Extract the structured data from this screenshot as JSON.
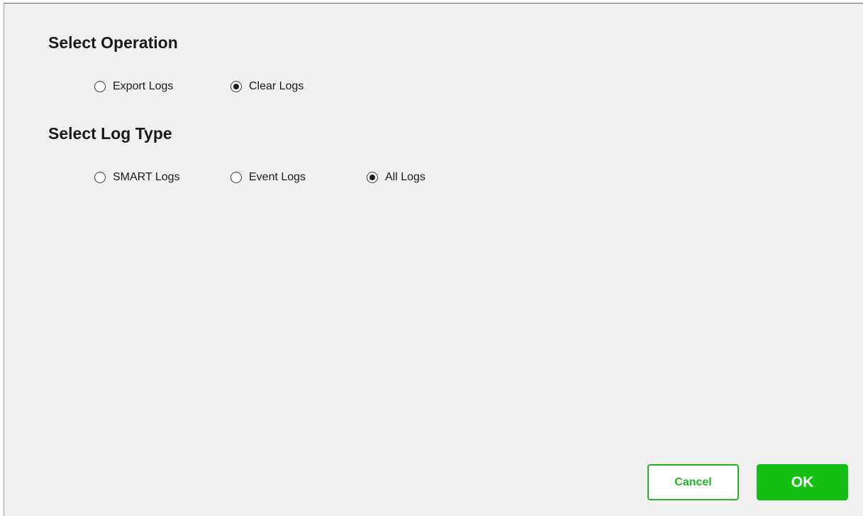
{
  "operation": {
    "title": "Select Operation",
    "options": [
      {
        "label": "Export Logs",
        "checked": false
      },
      {
        "label": "Clear Logs",
        "checked": true
      }
    ]
  },
  "log_type": {
    "title": "Select Log Type",
    "options": [
      {
        "label": "SMART Logs",
        "checked": false
      },
      {
        "label": "Event Logs",
        "checked": false
      },
      {
        "label": "All Logs",
        "checked": true
      }
    ]
  },
  "buttons": {
    "cancel_label": "Cancel",
    "ok_label": "OK"
  },
  "colors": {
    "accent": "#13c013",
    "background": "#f0f0f0"
  }
}
